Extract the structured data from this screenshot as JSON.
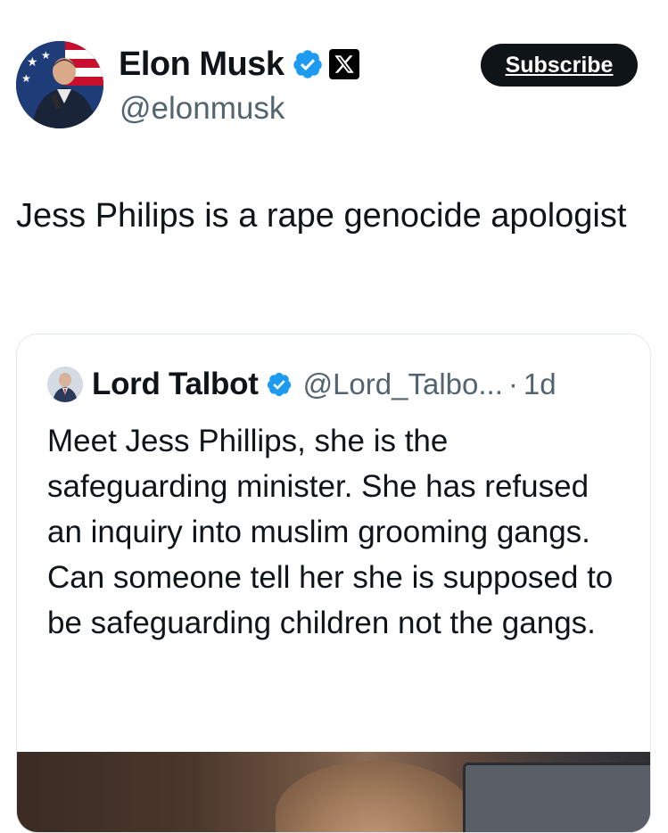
{
  "author": {
    "name": "Elon Musk",
    "handle": "@elonmusk",
    "verified": true,
    "affiliate_badge": "x-logo-icon"
  },
  "actions": {
    "subscribe_label": "Subscribe"
  },
  "post": {
    "text": "Jess Philips is a rape genocide apologist"
  },
  "quoted_post": {
    "author_name": "Lord Talbot",
    "author_handle": "@Lord_Talbo...",
    "separator": "·",
    "time": "1d",
    "verified": true,
    "text": "Meet Jess Phillips, she is the safeguarding minister. She has refused an inquiry into muslim grooming gangs. Can someone tell her she is supposed to be safeguarding children not the gangs."
  },
  "colors": {
    "text_primary": "#0f1419",
    "text_secondary": "#536471",
    "verified_blue": "#1d9bf0",
    "button_bg": "#0f1419",
    "border": "#e1e8ed"
  }
}
